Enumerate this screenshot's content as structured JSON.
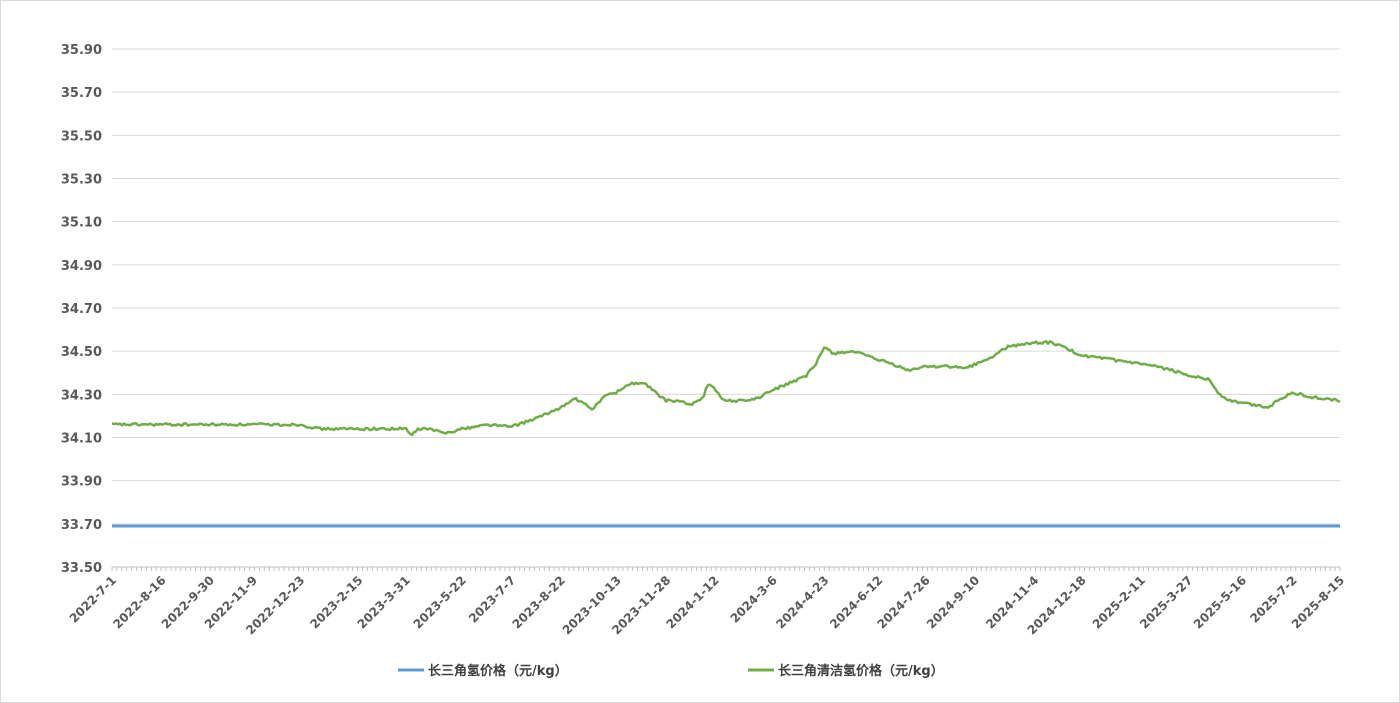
{
  "chart_data": {
    "type": "line",
    "title": "",
    "xlabel": "",
    "ylabel": "",
    "ylim": [
      33.5,
      35.9
    ],
    "y_ticks": [
      "33.50",
      "33.70",
      "33.90",
      "34.10",
      "34.30",
      "34.50",
      "34.70",
      "34.90",
      "35.10",
      "35.30",
      "35.50",
      "35.70",
      "35.90"
    ],
    "x_range": [
      "2022-7-1",
      "2025-8-15"
    ],
    "x_ticks": [
      "2022-7-1",
      "2022-8-16",
      "2022-9-30",
      "2022-11-9",
      "2022-12-23",
      "2023-2-15",
      "2023-3-31",
      "2023-5-22",
      "2023-7-7",
      "2023-8-22",
      "2023-10-13",
      "2023-11-28",
      "2024-1-12",
      "2024-3-6",
      "2024-4-23",
      "2024-6-12",
      "2024-7-26",
      "2024-9-10",
      "2024-11-4",
      "2024-12-18",
      "2025-2-11",
      "2025-3-27",
      "2025-5-16",
      "2025-7-2",
      "2025-8-15"
    ],
    "grid": true,
    "legend_position": "bottom",
    "series": [
      {
        "name": "长三角氢价格（元/kg）",
        "color": "#5b9bd5",
        "points": [
          [
            "2022-7-1",
            33.69
          ],
          [
            "2025-8-15",
            33.69
          ]
        ]
      },
      {
        "name": "长三角清洁氢价格（元/kg）",
        "color": "#70ad47",
        "points": [
          [
            "2022-7-1",
            34.16
          ],
          [
            "2022-8-16",
            34.16
          ],
          [
            "2022-9-30",
            34.16
          ],
          [
            "2022-11-9",
            34.16
          ],
          [
            "2022-12-23",
            34.16
          ],
          [
            "2023-1-10",
            34.14
          ],
          [
            "2023-2-15",
            34.14
          ],
          [
            "2023-3-10",
            34.14
          ],
          [
            "2023-3-31",
            34.14
          ],
          [
            "2023-4-5",
            34.11
          ],
          [
            "2023-4-12",
            34.14
          ],
          [
            "2023-4-22",
            34.14
          ],
          [
            "2023-5-5",
            34.12
          ],
          [
            "2023-5-22",
            34.14
          ],
          [
            "2023-6-15",
            34.16
          ],
          [
            "2023-7-7",
            34.15
          ],
          [
            "2023-7-25",
            34.18
          ],
          [
            "2023-8-5",
            34.2
          ],
          [
            "2023-8-22",
            34.24
          ],
          [
            "2023-9-5",
            34.28
          ],
          [
            "2023-9-20",
            34.23
          ],
          [
            "2023-10-1",
            34.29
          ],
          [
            "2023-10-13",
            34.31
          ],
          [
            "2023-10-25",
            34.35
          ],
          [
            "2023-11-8",
            34.35
          ],
          [
            "2023-11-20",
            34.3
          ],
          [
            "2023-11-28",
            34.27
          ],
          [
            "2023-12-10",
            34.27
          ],
          [
            "2023-12-20",
            34.25
          ],
          [
            "2024-1-1",
            34.28
          ],
          [
            "2024-1-5",
            34.35
          ],
          [
            "2024-1-12",
            34.33
          ],
          [
            "2024-1-20",
            34.27
          ],
          [
            "2024-2-5",
            34.27
          ],
          [
            "2024-2-20",
            34.28
          ],
          [
            "2024-3-6",
            34.32
          ],
          [
            "2024-3-25",
            34.36
          ],
          [
            "2024-4-5",
            34.38
          ],
          [
            "2024-4-15",
            34.44
          ],
          [
            "2024-4-23",
            34.52
          ],
          [
            "2024-5-1",
            34.49
          ],
          [
            "2024-5-20",
            34.5
          ],
          [
            "2024-6-5",
            34.47
          ],
          [
            "2024-6-12",
            34.46
          ],
          [
            "2024-6-25",
            34.44
          ],
          [
            "2024-7-10",
            34.41
          ],
          [
            "2024-7-26",
            34.43
          ],
          [
            "2024-8-15",
            34.43
          ],
          [
            "2024-9-1",
            34.42
          ],
          [
            "2024-9-10",
            34.44
          ],
          [
            "2024-9-25",
            34.47
          ],
          [
            "2024-10-10",
            34.52
          ],
          [
            "2024-11-4",
            34.54
          ],
          [
            "2024-11-20",
            34.54
          ],
          [
            "2024-12-5",
            34.51
          ],
          [
            "2024-12-18",
            34.48
          ],
          [
            "2025-1-15",
            34.46
          ],
          [
            "2025-2-11",
            34.44
          ],
          [
            "2025-3-5",
            34.42
          ],
          [
            "2025-3-27",
            34.39
          ],
          [
            "2025-4-15",
            34.37
          ],
          [
            "2025-4-25",
            34.3
          ],
          [
            "2025-5-5",
            34.27
          ],
          [
            "2025-5-16",
            34.26
          ],
          [
            "2025-6-10",
            34.24
          ],
          [
            "2025-6-20",
            34.28
          ],
          [
            "2025-7-2",
            34.31
          ],
          [
            "2025-7-15",
            34.29
          ],
          [
            "2025-8-1",
            34.28
          ],
          [
            "2025-8-15",
            34.27
          ]
        ]
      }
    ]
  }
}
